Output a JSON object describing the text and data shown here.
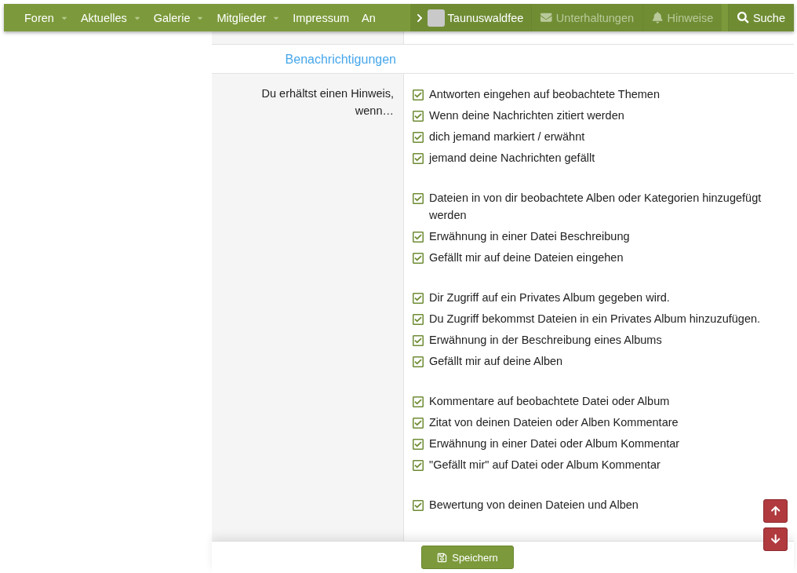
{
  "nav": {
    "items": [
      {
        "label": "Foren",
        "has_menu": true
      },
      {
        "label": "Aktuelles",
        "has_menu": true
      },
      {
        "label": "Galerie",
        "has_menu": true
      },
      {
        "label": "Mitglieder",
        "has_menu": true
      },
      {
        "label": "Impressum",
        "has_menu": false
      },
      {
        "label": "An",
        "has_menu": false
      }
    ],
    "user": {
      "name": "Taunuswaldfee"
    },
    "actions": [
      {
        "kind": "conversations",
        "label": "Unterhaltungen",
        "muted": true
      },
      {
        "kind": "alerts",
        "label": "Hinweise",
        "muted": true
      },
      {
        "kind": "search",
        "label": "Suche",
        "muted": false
      }
    ]
  },
  "section": {
    "title": "Benachrichtigungen"
  },
  "notifications": {
    "label": "Du erhältst einen Hinweis, wenn…",
    "groups": [
      [
        {
          "label": "Antworten eingehen auf beobachtete Themen",
          "checked": true
        },
        {
          "label": "Wenn deine Nachrichten zitiert werden",
          "checked": true
        },
        {
          "label": "dich jemand markiert / erwähnt",
          "checked": true
        },
        {
          "label": "jemand deine Nachrichten gefällt",
          "checked": true
        }
      ],
      [
        {
          "label": "Dateien in von dir beobachtete Alben oder Kategorien hinzugefügt werden",
          "checked": true
        },
        {
          "label": "Erwähnung in einer Datei Beschreibung",
          "checked": true
        },
        {
          "label": "Gefällt mir auf deine Dateien eingehen",
          "checked": true
        }
      ],
      [
        {
          "label": "Dir Zugriff auf ein Privates Album gegeben wird.",
          "checked": true
        },
        {
          "label": "Du Zugriff bekommst Dateien in ein Privates Album hinzuzufügen.",
          "checked": true
        },
        {
          "label": "Erwähnung in der Beschreibung eines Albums",
          "checked": true
        },
        {
          "label": "Gefällt mir auf deine Alben",
          "checked": true
        }
      ],
      [
        {
          "label": "Kommentare auf beobachtete Datei oder Album",
          "checked": true
        },
        {
          "label": "Zitat von deinen Dateien oder Alben Kommentare",
          "checked": true
        },
        {
          "label": "Erwähnung in einer Datei oder Album Kommentar",
          "checked": true
        },
        {
          "label": "\"Gefällt mir\" auf Datei oder Album Kommentar",
          "checked": true
        }
      ],
      [
        {
          "label": "Bewertung von deinen Dateien und Alben",
          "checked": true
        }
      ]
    ]
  },
  "footer": {
    "save_label": "Speichern"
  }
}
